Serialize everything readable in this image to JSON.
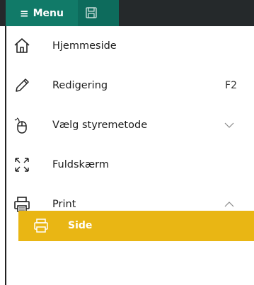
{
  "topbar": {
    "menu_label": "Menu"
  },
  "menu": {
    "items": [
      {
        "label": "Hjemmeside",
        "icon": "home-icon"
      },
      {
        "label": "Redigering",
        "shortcut": "F2",
        "icon": "pencil-icon"
      },
      {
        "label": "Vælg styremetode",
        "icon": "pointer-icon",
        "expanded": false
      },
      {
        "label": "Fuldskærm",
        "icon": "fullscreen-icon"
      },
      {
        "label": "Print",
        "icon": "printer-icon",
        "expanded": true
      }
    ],
    "submenu": {
      "label": "Side",
      "icon": "printer-icon"
    }
  },
  "colors": {
    "topbar_dark": "#25292b",
    "menu_teal": "#117a68",
    "highlight_yellow": "#e9b614"
  }
}
